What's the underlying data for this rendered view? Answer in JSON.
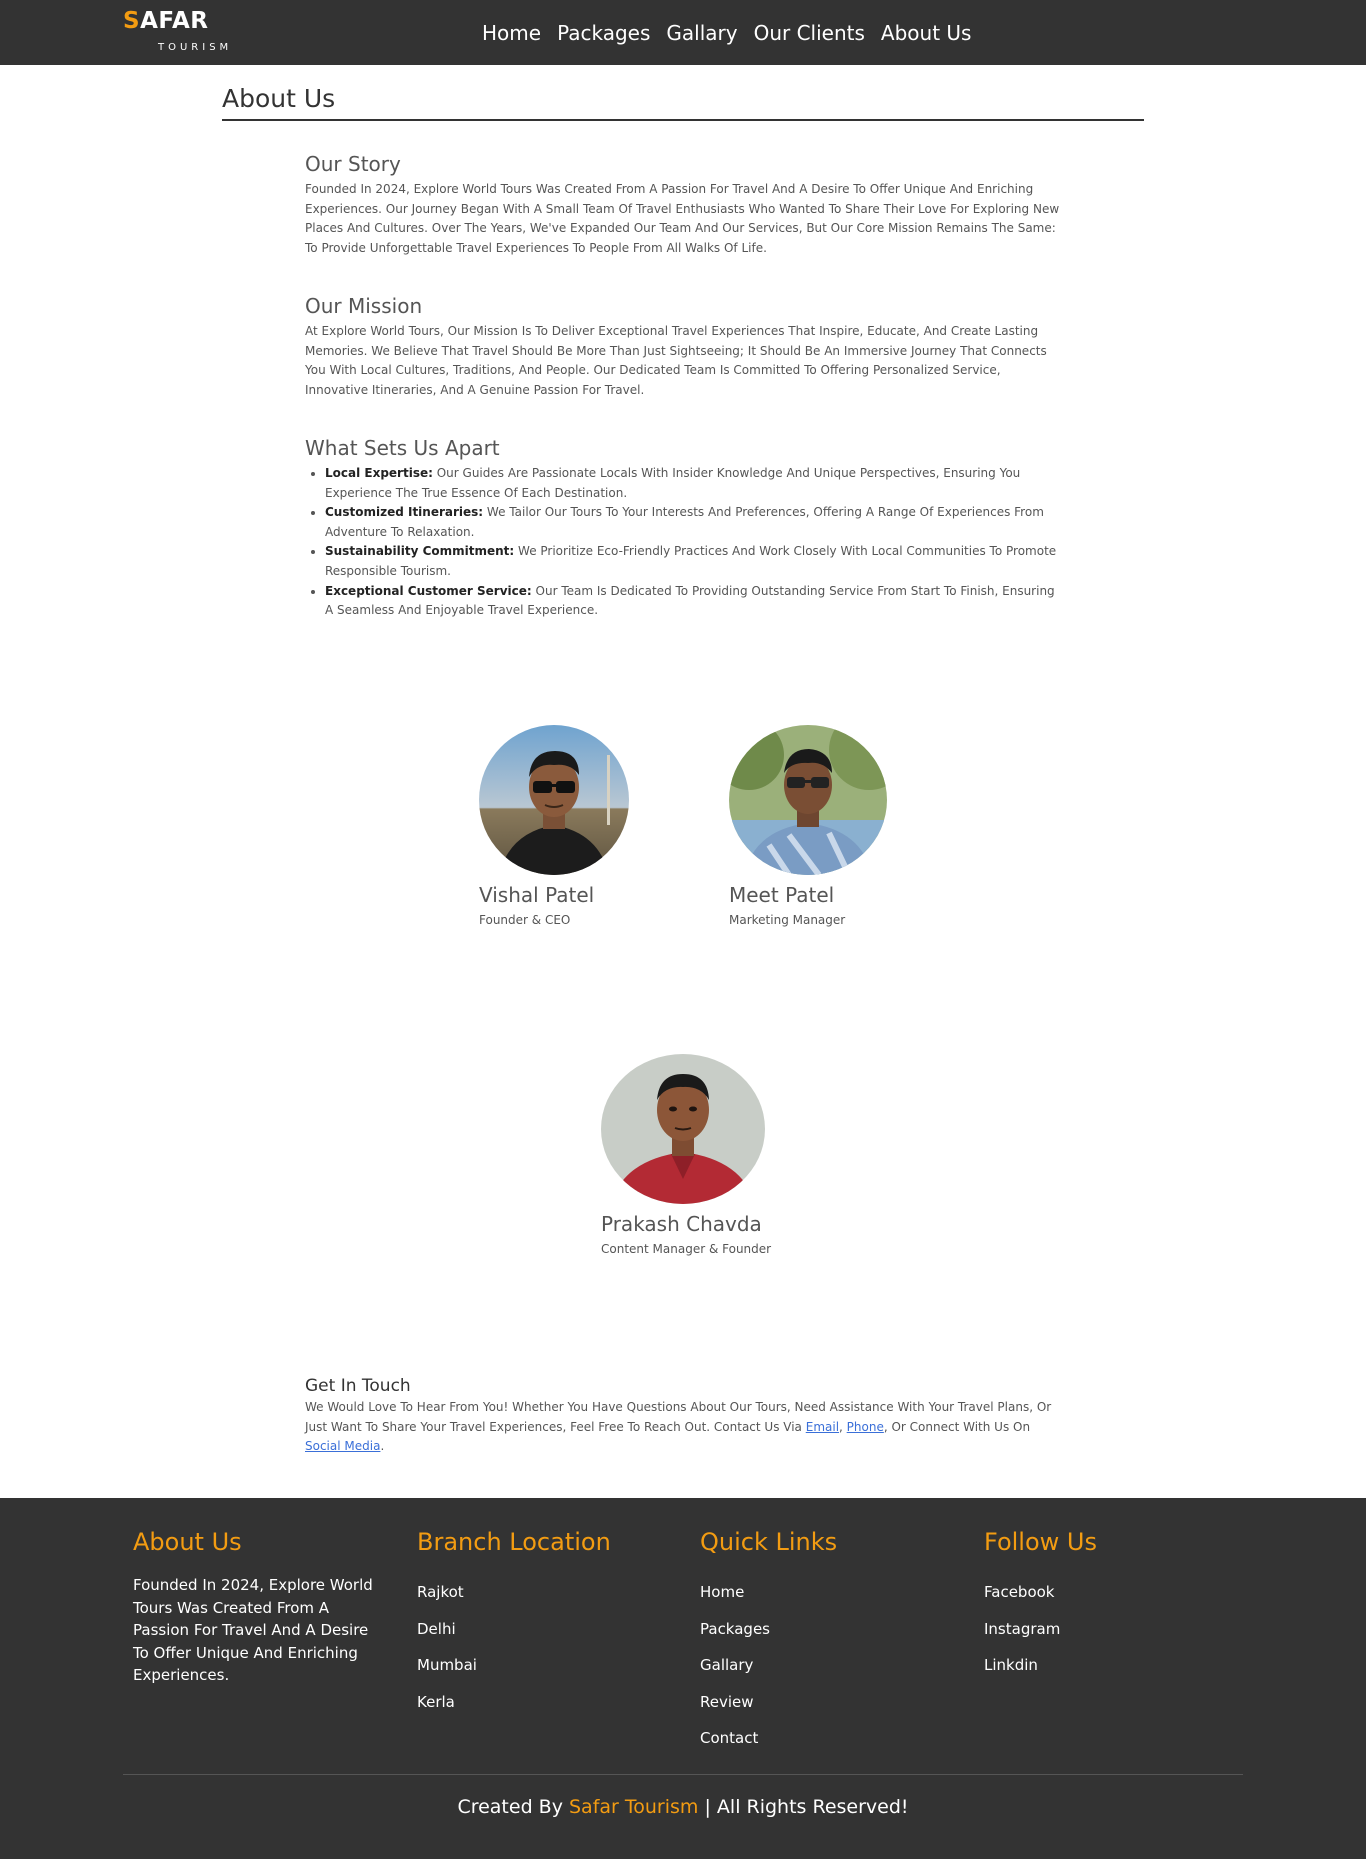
{
  "brand": {
    "logo_first": "S",
    "logo_rest": "AFAR",
    "logo_sub": "TOURISM",
    "accent": "#f39c12"
  },
  "nav": [
    {
      "label": "Home"
    },
    {
      "label": "Packages"
    },
    {
      "label": "Gallary"
    },
    {
      "label": "Our Clients"
    },
    {
      "label": "About Us"
    }
  ],
  "page_title": "About Us",
  "story": {
    "title": "Our Story",
    "text": "Founded In 2024, Explore World Tours Was Created From A Passion For Travel And A Desire To Offer Unique And Enriching Experiences. Our Journey Began With A Small Team Of Travel Enthusiasts Who Wanted To Share Their Love For Exploring New Places And Cultures. Over The Years, We've Expanded Our Team And Our Services, But Our Core Mission Remains The Same: To Provide Unforgettable Travel Experiences To People From All Walks Of Life."
  },
  "mission": {
    "title": "Our Mission",
    "text": "At Explore World Tours, Our Mission Is To Deliver Exceptional Travel Experiences That Inspire, Educate, And Create Lasting Memories. We Believe That Travel Should Be More Than Just Sightseeing; It Should Be An Immersive Journey That Connects You With Local Cultures, Traditions, And People. Our Dedicated Team Is Committed To Offering Personalized Service, Innovative Itineraries, And A Genuine Passion For Travel."
  },
  "apart": {
    "title": "What Sets Us Apart",
    "items": [
      {
        "label": "Local Expertise:",
        "text": " Our Guides Are Passionate Locals With Insider Knowledge And Unique Perspectives, Ensuring You Experience The True Essence Of Each Destination."
      },
      {
        "label": "Customized Itineraries:",
        "text": " We Tailor Our Tours To Your Interests And Preferences, Offering A Range Of Experiences From Adventure To Relaxation."
      },
      {
        "label": "Sustainability Commitment:",
        "text": " We Prioritize Eco-Friendly Practices And Work Closely With Local Communities To Promote Responsible Tourism."
      },
      {
        "label": "Exceptional Customer Service:",
        "text": " Our Team Is Dedicated To Providing Outstanding Service From Start To Finish, Ensuring A Seamless And Enjoyable Travel Experience."
      }
    ]
  },
  "team": [
    {
      "name": "Vishal Patel",
      "role": "Founder & CEO"
    },
    {
      "name": "Meet Patel",
      "role": "Marketing Manager"
    },
    {
      "name": "Prakash Chavda",
      "role": "Content Manager & Founder"
    }
  ],
  "touch": {
    "title": "Get In Touch",
    "text_a": "We Would Love To Hear From You! Whether You Have Questions About Our Tours, Need Assistance With Your Travel Plans, Or Just Want To Share Your Travel Experiences, Feel Free To Reach Out. Contact Us Via ",
    "email": "Email",
    "sep1": ", ",
    "phone": "Phone",
    "text_b": ", Or Connect With Us On ",
    "social": "Social Media",
    "end": "."
  },
  "footer": {
    "about": {
      "title": "About Us",
      "text": "Founded In 2024, Explore World Tours Was Created From A Passion For Travel And A Desire To Offer Unique And Enriching Experiences."
    },
    "branch": {
      "title": "Branch Location",
      "items": [
        "Rajkot",
        "Delhi",
        "Mumbai",
        "Kerla"
      ]
    },
    "quick": {
      "title": "Quick Links",
      "items": [
        "Home",
        "Packages",
        "Gallary",
        "Review",
        "Contact"
      ]
    },
    "follow": {
      "title": "Follow Us",
      "items": [
        "Facebook",
        "Instagram",
        "Linkdin"
      ]
    },
    "bottom_a": "Created By ",
    "bottom_brand": "Safar Tourism",
    "bottom_b": " | All Rights Reserved!"
  }
}
